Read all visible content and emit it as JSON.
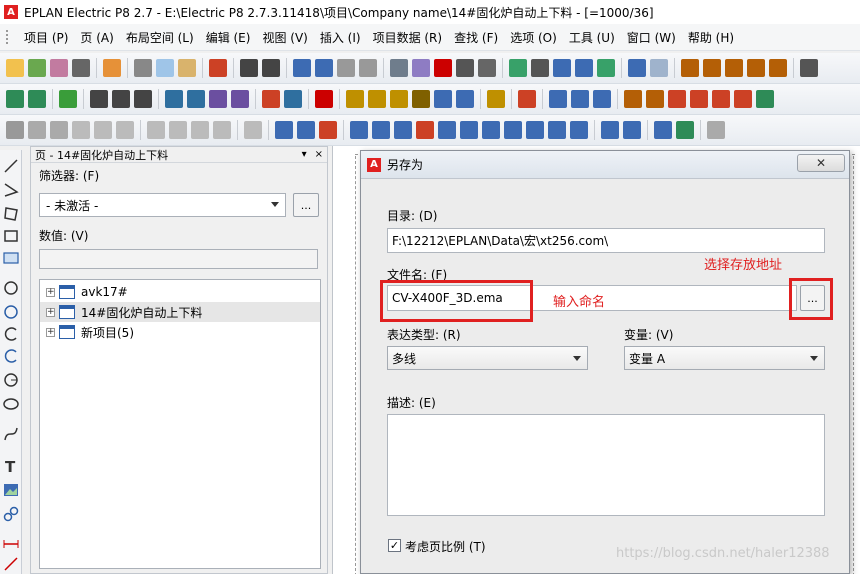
{
  "window": {
    "title": "EPLAN Electric P8 2.7 - E:\\Electric P8 2.7.3.11418\\项目\\Company name\\14#固化炉自动上下料 - [=1000/36]",
    "logo_glyph": "A"
  },
  "menu": [
    "项目 (P)",
    "页 (A)",
    "布局空间 (L)",
    "编辑 (E)",
    "视图 (V)",
    "插入 (I)",
    "项目数据 (R)",
    "查找 (F)",
    "选项 (O)",
    "工具 (U)",
    "窗口 (W)",
    "帮助 (H)"
  ],
  "panel": {
    "title": "页 - 14#固化炉自动上下料",
    "pin_glyph": "▾",
    "close_glyph": "×",
    "filter_label": "筛选器: (F)",
    "filter_value": "- 未激活 -",
    "filter_button": "...",
    "value_label": "数值: (V)",
    "tree": [
      {
        "label": "avk17#",
        "expander": "+"
      },
      {
        "label": "14#固化炉自动上下料",
        "expander": "+"
      },
      {
        "label": "新项目(5)",
        "expander": "+"
      }
    ]
  },
  "dialog": {
    "title": "另存为",
    "logo_glyph": "A",
    "close_glyph": "✕",
    "dir_label": "目录: (D)",
    "dir_value": "F:\\12212\\EPLAN\\Data\\宏\\xt256.com\\",
    "file_label": "文件名: (F)",
    "file_value": "CV-X400F_3D.ema",
    "browse_button": "...",
    "repr_label": "表达类型: (R)",
    "repr_value": "多线",
    "variant_label": "变量: (V)",
    "variant_value": "变量 A",
    "desc_label": "描述: (E)",
    "checkbox_label": "考虑页比例 (T)",
    "checkbox_mark": "✓",
    "checkbox_checked": true
  },
  "annotations": {
    "browse_hint": "选择存放地址",
    "name_hint": "输入命名"
  },
  "watermark": "https://blog.csdn.net/haler12388"
}
